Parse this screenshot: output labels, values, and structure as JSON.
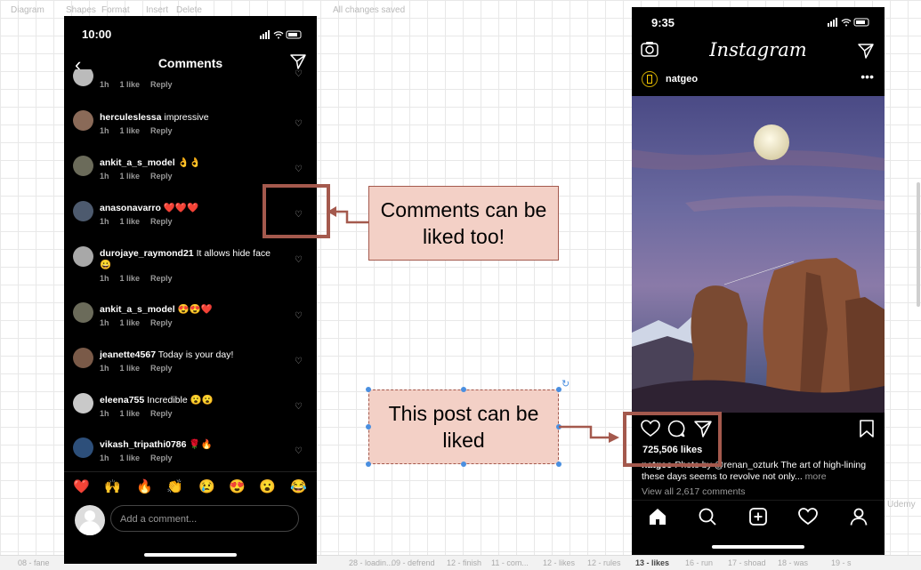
{
  "app": {
    "toolbar": [
      "Diagram",
      "Shapes",
      "Format",
      "Insert",
      "Delete",
      "All changes saved"
    ],
    "bottom_tabs": [
      "08 - fane",
      "28 - loadin...",
      "09 - defrend",
      "12 - finish",
      "11 - com...",
      "12 - likes",
      "12 - rules",
      "13 - likes",
      "16 - run",
      "17 - shoad",
      "18 - was",
      "19 - s"
    ],
    "active_tab_index": 7,
    "watermark": "Udemy"
  },
  "left_phone": {
    "time": "10:00",
    "header_title": "Comments",
    "comments": [
      {
        "user": "",
        "text": "",
        "time": "1h",
        "likes": "1 like",
        "reply": "Reply",
        "avatar_color": "#bbbbbb"
      },
      {
        "user": "herculeslessa",
        "text": "impressive",
        "time": "1h",
        "likes": "1 like",
        "reply": "Reply",
        "avatar_color": "#8a6a58"
      },
      {
        "user": "ankit_a_s_model",
        "text": "👌👌",
        "time": "1h",
        "likes": "1 like",
        "reply": "Reply",
        "avatar_color": "#6b6b5a"
      },
      {
        "user": "anasonavarro",
        "text": "❤️❤️❤️",
        "time": "1h",
        "likes": "1 like",
        "reply": "Reply",
        "avatar_color": "#4d5a6e"
      },
      {
        "user": "durojaye_raymond21",
        "text": "It allows hide face 😀",
        "time": "1h",
        "likes": "1 like",
        "reply": "Reply",
        "avatar_color": "#a8a8a8"
      },
      {
        "user": "ankit_a_s_model",
        "text": "😍😍❤️",
        "time": "1h",
        "likes": "1 like",
        "reply": "Reply",
        "avatar_color": "#6b6b5a"
      },
      {
        "user": "jeanette4567",
        "text": "Today is your day!",
        "time": "1h",
        "likes": "1 like",
        "reply": "Reply",
        "avatar_color": "#7a5a48"
      },
      {
        "user": "eleena755",
        "text": "Incredible 😮😮",
        "time": "1h",
        "likes": "1 like",
        "reply": "Reply",
        "avatar_color": "#c9c9c9"
      },
      {
        "user": "vikash_tripathi0786",
        "text": "🌹🔥",
        "time": "1h",
        "likes": "1 like",
        "reply": "Reply",
        "avatar_color": "#2d4f7a"
      }
    ],
    "emojis": [
      "❤️",
      "🙌",
      "🔥",
      "👏",
      "😢",
      "😍",
      "😮",
      "😂"
    ],
    "add_comment_placeholder": "Add a comment..."
  },
  "right_phone": {
    "time": "9:35",
    "logo": "Instagram",
    "post_user": "natgeo",
    "likes": "725,506 likes",
    "caption_user": "natgeo",
    "caption_text": "Photo by @renan_ozturk  The art of high-lining these days seems to revolve not only...",
    "caption_more": "more",
    "view_all_comments": "View all 2,617 comments"
  },
  "annotations": {
    "comments_callout": "Comments can be liked too!",
    "post_callout": "This post can be liked"
  },
  "colors": {
    "callout_fill": "#f3d0c6",
    "callout_border": "#a4594d",
    "selection": "#4a8fe0"
  }
}
